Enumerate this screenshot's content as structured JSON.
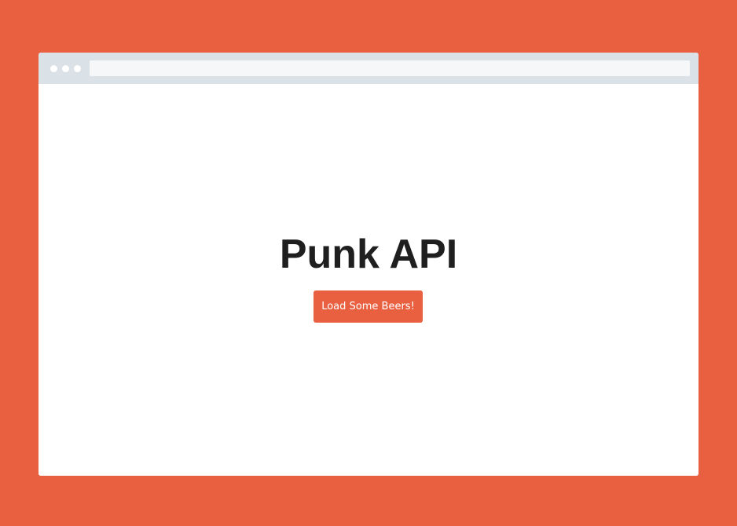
{
  "colors": {
    "background": "#E96041",
    "accent": "#E96041",
    "chrome": "#DAE1E7",
    "address_bar": "#F5F7F9",
    "window": "#FFFFFF",
    "title_text": "#1F1F1F",
    "button_text": "#FFFFFF"
  },
  "browser": {
    "window_controls": [
      "dot",
      "dot",
      "dot"
    ],
    "address_bar_value": ""
  },
  "page": {
    "title": "Punk API",
    "load_button_label": "Load Some Beers!"
  }
}
